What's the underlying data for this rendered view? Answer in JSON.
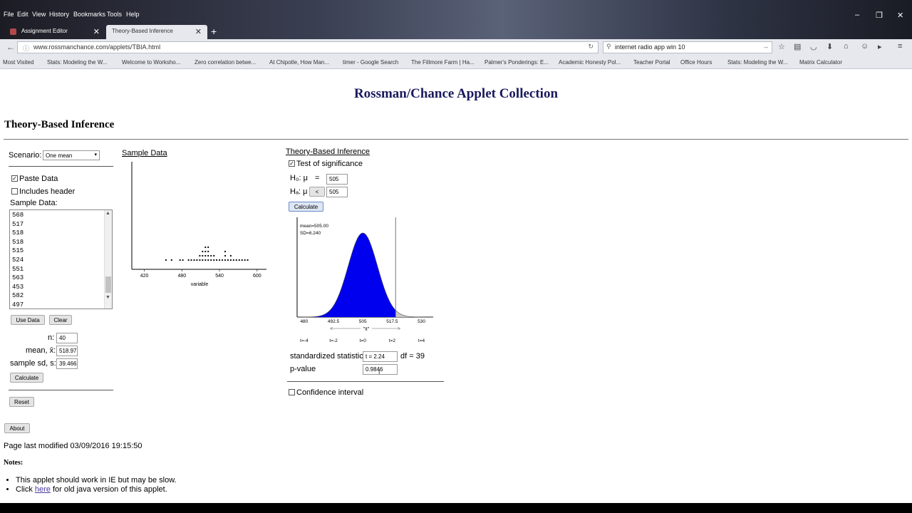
{
  "browser": {
    "menu": [
      "File",
      "Edit",
      "View",
      "History",
      "Bookmarks",
      "Tools",
      "Help"
    ],
    "window_controls": [
      "–",
      "❐",
      "✕"
    ],
    "tabs": [
      {
        "label": "Assignment Editor",
        "active": false
      },
      {
        "label": "Theory-Based Inference",
        "active": true
      }
    ],
    "new_tab": "+",
    "url": "www.rossmanchance.com/applets/TBIA.html",
    "search_value": "internet radio app win 10",
    "bookmarks": [
      "Most Visited",
      "Stats: Modeling the W...",
      "Welcome to Worksho...",
      "Zero correlation betwe...",
      "At Chipotle, How Man...",
      "timer - Google Search",
      "The Fillmore Farm | Ha...",
      "Palmer's Ponderings: E...",
      "Academic Honesty Pol...",
      "Teacher Portal",
      "Office Hours",
      "Stats: Modeling the W...",
      "Matrix Calculator"
    ]
  },
  "page": {
    "site_title": "Rossman/Chance Applet Collection",
    "heading": "Theory-Based Inference",
    "scenario_label": "Scenario:",
    "scenario_value": "One mean",
    "paste_data_label": "Paste Data",
    "paste_data_checked": true,
    "includes_header_label": "Includes header",
    "includes_header_checked": false,
    "sample_data_label": "Sample Data:",
    "sample_values": [
      "568",
      "517",
      "518",
      "518",
      "515",
      "524",
      "551",
      "563",
      "453",
      "582",
      "497"
    ],
    "use_data_button": "Use Data",
    "clear_button": "Clear",
    "n_label": "n:",
    "n_value": "40",
    "mean_label": "mean, x̄:",
    "mean_value": "518.97",
    "sd_label": "sample sd, s:",
    "sd_value": "39.466",
    "calculate_button": "Calculate",
    "reset_button": "Reset",
    "about_button": "About",
    "last_modified": "Page last modified 03/09/2016 19:15:50",
    "notes_label": "Notes",
    "note_1": "This applet should work in IE but may be slow.",
    "note_2_prefix": "Click ",
    "note_2_link": "here",
    "note_2_suffix": " for old java version of this applet."
  },
  "sample_panel": {
    "title": "Sample Data",
    "xlabel": "variable",
    "ticks": [
      "420",
      "480",
      "540",
      "600"
    ]
  },
  "inference_panel": {
    "title": "Theory-Based Inference",
    "test_label": "Test of significance",
    "test_checked": true,
    "h0_label": "H₀: μ",
    "h0_op": "=",
    "h0_value": "505",
    "ha_label": "Hₐ: μ",
    "ha_op": "<",
    "ha_value": "505",
    "calculate_button": "Calculate",
    "dist_mean_text": "mean=505.00",
    "dist_sd_text": "SD=6.240",
    "x_ticks": [
      "480",
      "492.5",
      "505",
      "517.5",
      "530"
    ],
    "x_axis_label": "\"x̄\"",
    "t_ticks": [
      "t=-4",
      "t=-2",
      "t=0",
      "t=2",
      "t=4"
    ],
    "std_stat_label": "standardized statistic",
    "std_stat_value": "t = 2.24",
    "df_text": "df = 39",
    "pvalue_label": "p-value",
    "pvalue_value": "0.9846",
    "ci_label": "Confidence interval",
    "ci_checked": false,
    "shade_color": "#0000ee"
  },
  "chart_data": [
    {
      "type": "scatter",
      "xlabel": "variable",
      "xlim": [
        400,
        615
      ],
      "xticks": [
        420,
        480,
        540,
        600
      ],
      "points_x": [
        453,
        465,
        477,
        480,
        489,
        496,
        500,
        505,
        508,
        510,
        512,
        514,
        515,
        516,
        517,
        518,
        519,
        520,
        521,
        522,
        524,
        526,
        527,
        530,
        533,
        536,
        540,
        545,
        548,
        550,
        551,
        555,
        558,
        560,
        563,
        568,
        570,
        575,
        582,
        587
      ]
    },
    {
      "type": "area",
      "xlim": [
        477,
        535
      ],
      "xticks": [
        480,
        492.5,
        505,
        517.5,
        530
      ],
      "mean": 505.0,
      "sd": 6.24,
      "observed": 518.97,
      "shaded": "left of 518.97",
      "p_value": 0.9846
    }
  ]
}
